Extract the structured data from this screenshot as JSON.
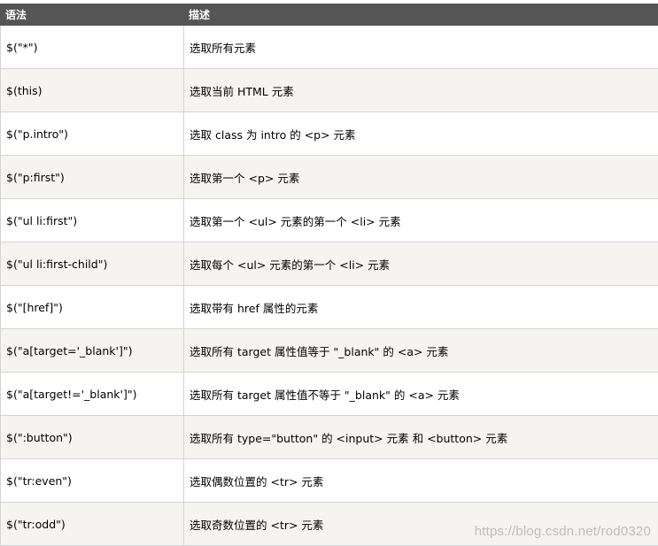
{
  "table": {
    "headers": {
      "syntax": "语法",
      "description": "描述"
    },
    "rows": [
      {
        "syntax": "$(\"*\")",
        "description": "选取所有元素"
      },
      {
        "syntax": "$(this)",
        "description": "选取当前 HTML 元素"
      },
      {
        "syntax": "$(\"p.intro\")",
        "description": "选取 class 为 intro 的 <p> 元素"
      },
      {
        "syntax": "$(\"p:first\")",
        "description": "选取第一个 <p> 元素"
      },
      {
        "syntax": "$(\"ul li:first\")",
        "description": "选取第一个 <ul> 元素的第一个 <li> 元素"
      },
      {
        "syntax": "$(\"ul li:first-child\")",
        "description": "选取每个 <ul> 元素的第一个 <li> 元素"
      },
      {
        "syntax": "$(\"[href]\")",
        "description": "选取带有 href 属性的元素"
      },
      {
        "syntax": "$(\"a[target='_blank']\")",
        "description": "选取所有 target 属性值等于 \"_blank\" 的 <a> 元素"
      },
      {
        "syntax": "$(\"a[target!='_blank']\")",
        "description": "选取所有 target 属性值不等于 \"_blank\" 的 <a> 元素"
      },
      {
        "syntax": "$(\":button\")",
        "description": "选取所有 type=\"button\" 的 <input> 元素 和 <button> 元素"
      },
      {
        "syntax": "$(\"tr:even\")",
        "description": "选取偶数位置的 <tr> 元素"
      },
      {
        "syntax": "$(\"tr:odd\")",
        "description": "选取奇数位置的 <tr> 元素"
      }
    ]
  },
  "watermark": "https://blog.csdn.net/rod0320"
}
